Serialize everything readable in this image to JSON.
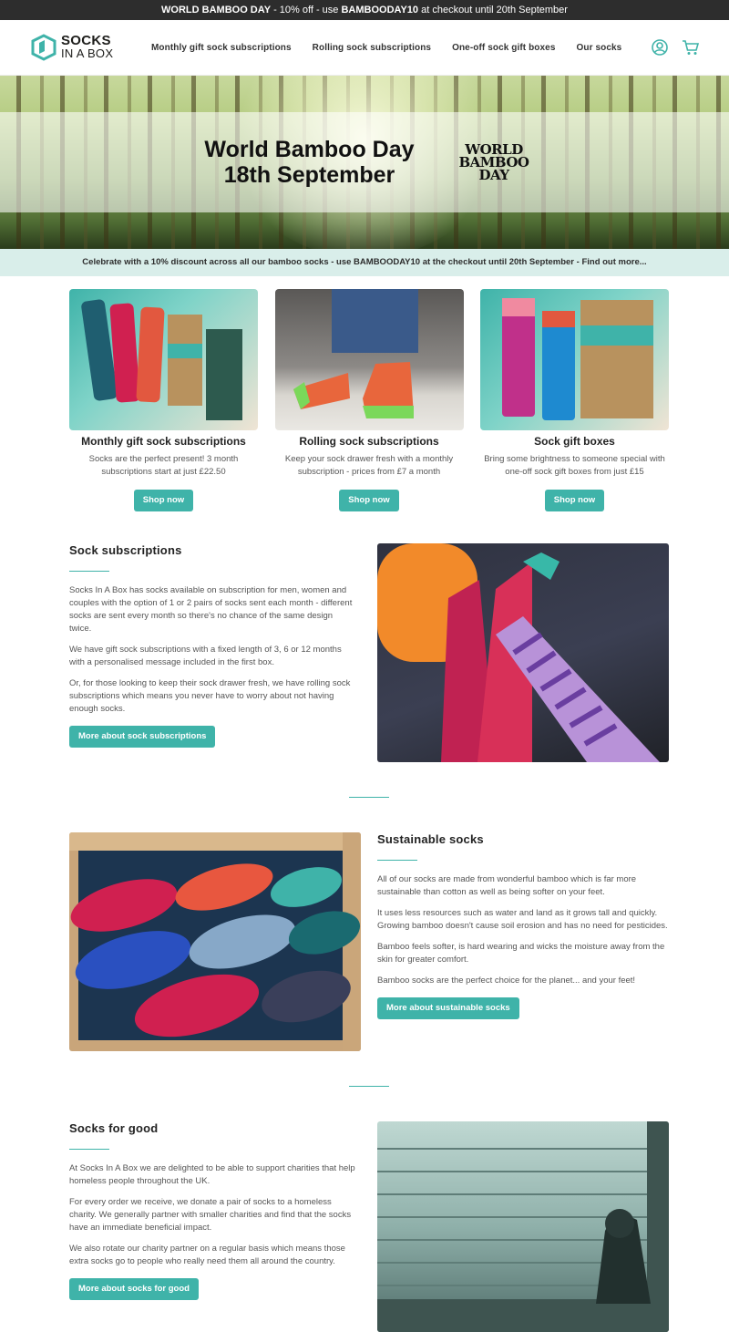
{
  "announcement": {
    "bold": "WORLD BAMBOO DAY",
    "text": " - 10% off - use ",
    "code": "BAMBOODAY10",
    "tail": " at checkout until 20th September"
  },
  "header": {
    "logo_top": "SOCKS",
    "logo_bottom": "IN A BOX",
    "nav": [
      "Monthly gift sock subscriptions",
      "Rolling sock subscriptions",
      "One-off sock gift boxes",
      "Our socks"
    ]
  },
  "hero": {
    "title_line1": "World Bamboo Day",
    "title_line2": "18th September",
    "badge_line1": "WORLD",
    "badge_line2": "BAMBOO",
    "badge_line3": "DAY"
  },
  "promo": "Celebrate with a 10% discount across all our bamboo socks - use BAMBOODAY10 at the checkout until 20th September - Find out more...",
  "cards": [
    {
      "title": "Monthly gift sock subscriptions",
      "text": "Socks are the perfect present! 3 month subscriptions start at just £22.50",
      "button": "Shop now"
    },
    {
      "title": "Rolling sock subscriptions",
      "text": "Keep your sock drawer fresh with a monthly subscription - prices from £7 a month",
      "button": "Shop now"
    },
    {
      "title": "Sock gift boxes",
      "text": "Bring some brightness to someone special with one-off sock gift boxes from just £15",
      "button": "Shop now"
    }
  ],
  "subscriptions": {
    "title": "Sock subscriptions",
    "paragraphs": [
      "Socks In A Box has socks available on subscription for men, women and couples with the option of 1 or 2 pairs of socks sent each month - different socks are sent every month so there's no chance of the same design twice.",
      "We have gift sock subscriptions with a fixed length of 3, 6 or 12 months with a personalised message included in the first box.",
      "Or, for those looking to keep their sock drawer fresh, we have rolling sock subscriptions which means you never have to worry about not having enough socks."
    ],
    "button": "More about sock subscriptions"
  },
  "sustainable": {
    "title": "Sustainable socks",
    "paragraphs": [
      "All of our socks are made from wonderful bamboo which is far more sustainable than cotton as well as being softer on your feet.",
      "It uses less resources such as water and land as it grows tall and quickly. Growing bamboo doesn't cause soil erosion and has no need for pesticides.",
      "Bamboo feels softer, is hard wearing and wicks the moisture away from the skin for greater comfort.",
      "Bamboo socks are the perfect choice for the planet... and your feet!"
    ],
    "button": "More about sustainable socks"
  },
  "good": {
    "title": "Socks for good",
    "paragraphs": [
      "At Socks In A Box we are delighted to be able to support charities that help homeless people throughout the UK.",
      "For every order we receive, we donate a pair of socks to a homeless charity. We generally partner with smaller charities and find that the socks have an immediate beneficial impact.",
      "We also rotate our charity partner on a regular basis which means those extra socks go to people who really need them all around the country."
    ],
    "button": "More about socks for good"
  },
  "colors": {
    "accent": "#3fb3a9",
    "announce_bg": "#2d2d2d",
    "promo_bg": "#d9eeea"
  },
  "icons": {
    "account": "user-circle-icon",
    "cart": "cart-icon"
  }
}
